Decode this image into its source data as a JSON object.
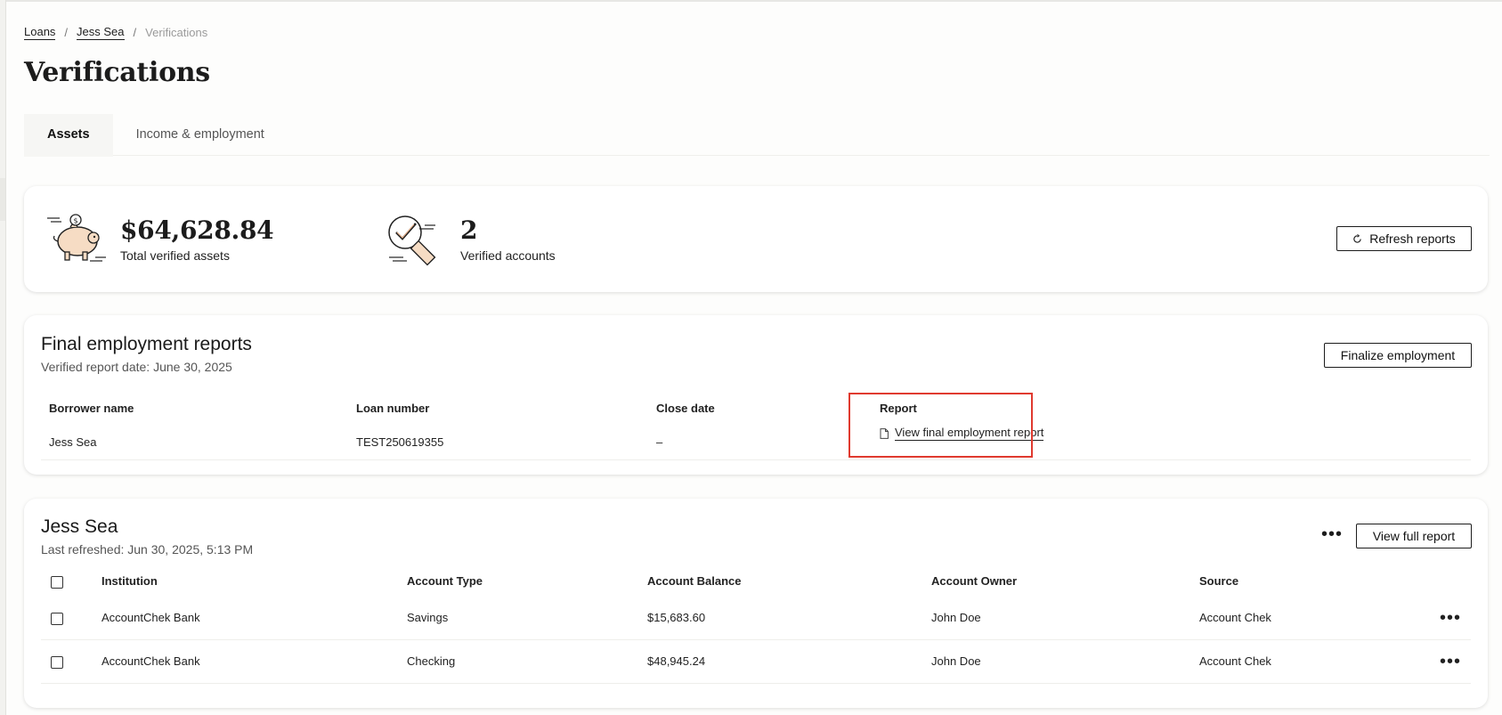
{
  "breadcrumb": {
    "loans": "Loans",
    "borrower": "Jess Sea",
    "current": "Verifications",
    "separator": "/"
  },
  "page": {
    "title": "Verifications"
  },
  "tabs": [
    {
      "label": "Assets",
      "active": true
    },
    {
      "label": "Income & employment",
      "active": false
    }
  ],
  "summary": {
    "total_assets_value": "$64,628.84",
    "total_assets_label": "Total verified assets",
    "verified_accounts_value": "2",
    "verified_accounts_label": "Verified accounts",
    "refresh_label": "Refresh reports",
    "icons": [
      "piggy-bank-icon",
      "verified-check-icon",
      "refresh-icon"
    ]
  },
  "employment": {
    "title": "Final employment reports",
    "subtitle": "Verified report date: June 30, 2025",
    "finalize_label": "Finalize employment",
    "columns": [
      "Borrower name",
      "Loan number",
      "Close date",
      "Report"
    ],
    "row": {
      "borrower": "Jess Sea",
      "loan_number": "TEST250619355",
      "close_date": "–",
      "report_link": "View final employment report"
    },
    "highlight_color": "#e03a2f"
  },
  "accounts": {
    "title": "Jess Sea",
    "subtitle": "Last refreshed: Jun 30, 2025, 5:13 PM",
    "more_label": "•••",
    "full_report_label": "View full report",
    "columns": [
      "Institution",
      "Account Type",
      "Account Balance",
      "Account Owner",
      "Source"
    ],
    "rows": [
      {
        "institution": "AccountChek Bank",
        "type": "Savings",
        "balance": "$15,683.60",
        "owner": "John Doe",
        "source": "Account Chek",
        "more": "•••"
      },
      {
        "institution": "AccountChek Bank",
        "type": "Checking",
        "balance": "$48,945.24",
        "owner": "John Doe",
        "source": "Account Chek",
        "more": "•••"
      }
    ]
  }
}
